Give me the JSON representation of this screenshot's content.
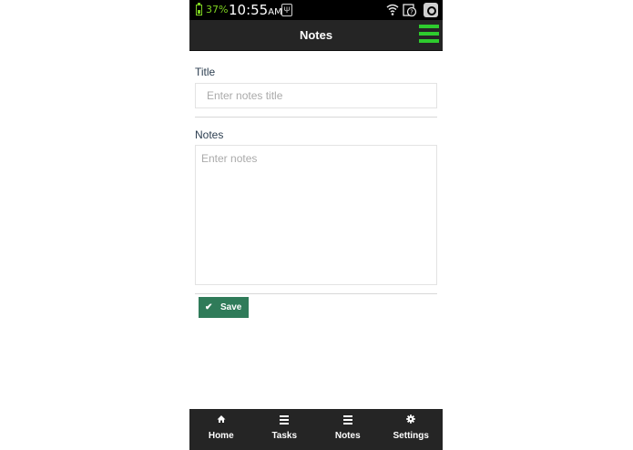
{
  "status_bar": {
    "battery_percent": "37%",
    "time": "10:55",
    "time_suffix": "AM",
    "icons": [
      "battery-icon",
      "usb-icon",
      "wifi-icon",
      "sync-icon",
      "camera-icon"
    ]
  },
  "header": {
    "title": "Notes",
    "menu_icon": "hamburger-menu-icon",
    "menu_color": "#2ecc2e"
  },
  "form": {
    "title_label": "Title",
    "title_placeholder": "Enter notes title",
    "title_value": "",
    "notes_label": "Notes",
    "notes_placeholder": "Enter notes",
    "notes_value": "",
    "save_label": "Save",
    "save_icon": "check-icon",
    "save_color": "#2f7b59"
  },
  "footer": {
    "items": [
      {
        "label": "Home",
        "icon": "home-icon"
      },
      {
        "label": "Tasks",
        "icon": "bars-icon"
      },
      {
        "label": "Notes",
        "icon": "bars-icon"
      },
      {
        "label": "Settings",
        "icon": "gear-icon"
      }
    ]
  }
}
